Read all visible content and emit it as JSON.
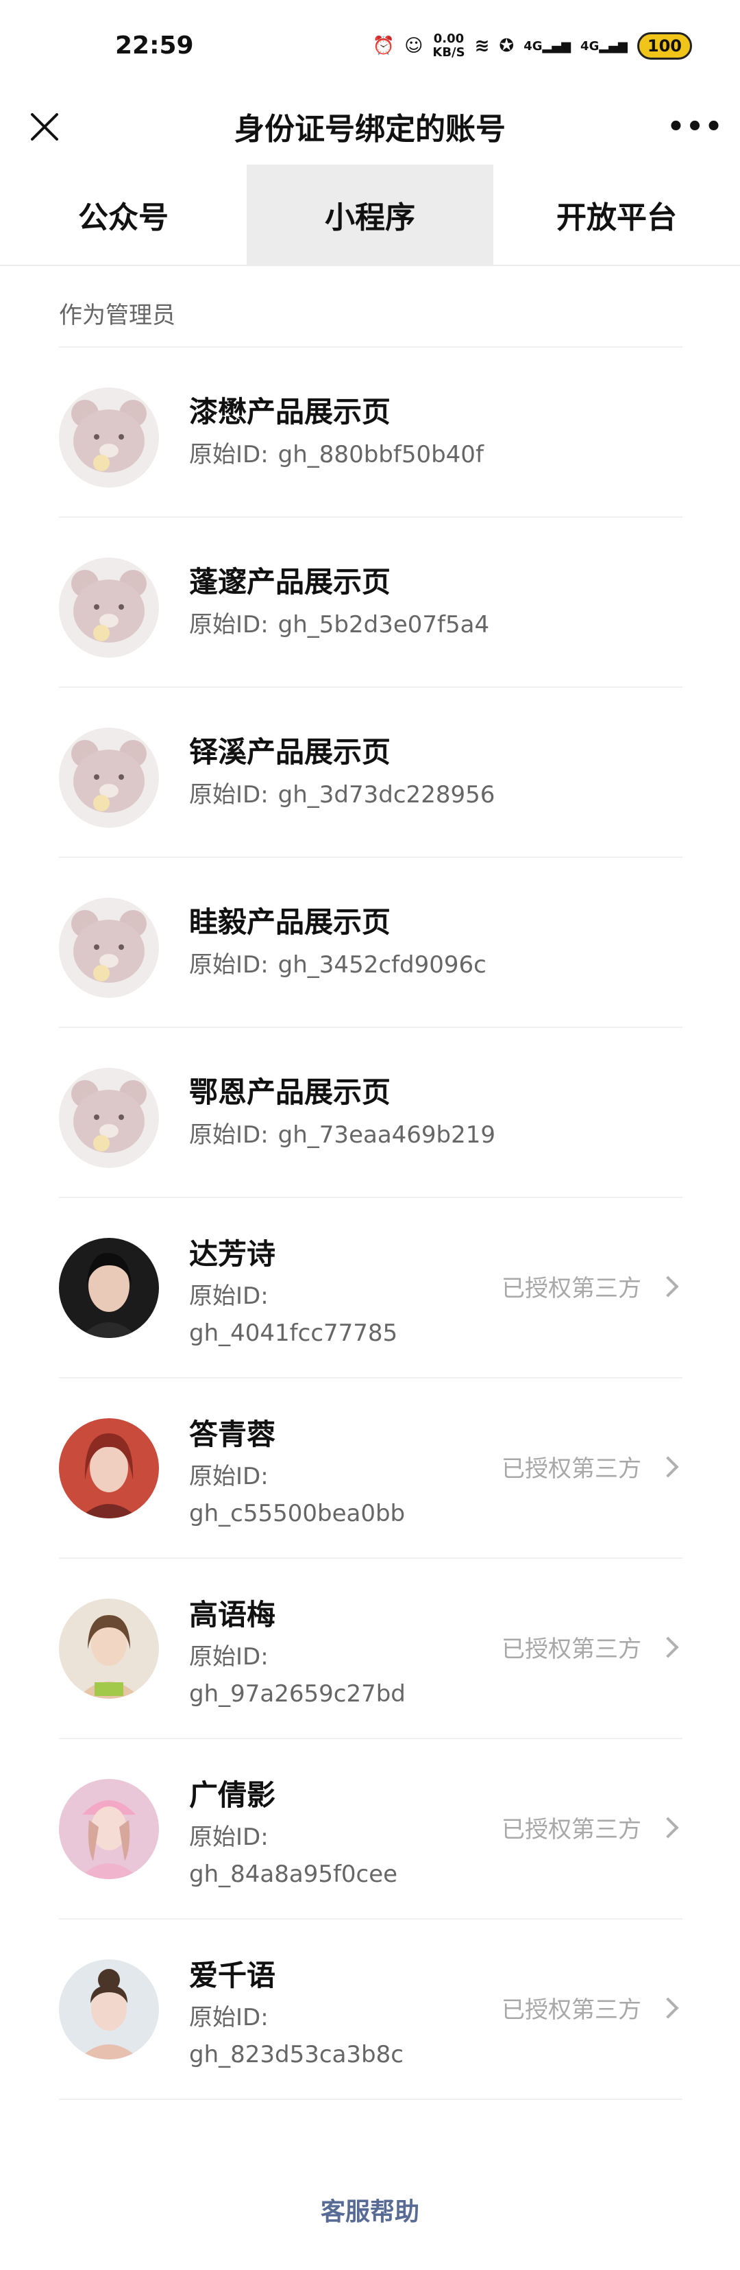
{
  "status_bar": {
    "time": "22:59",
    "speed_value": "0.00",
    "speed_unit": "KB/S",
    "signal_1": "4G",
    "signal_2": "4G",
    "battery": "100"
  },
  "title_bar": {
    "title": "身份证号绑定的账号",
    "close_icon": "close-icon",
    "more_icon": "more-icon"
  },
  "tabs": [
    {
      "label": "公众号",
      "active": false
    },
    {
      "label": "小程序",
      "active": true
    },
    {
      "label": "开放平台",
      "active": false
    }
  ],
  "section": {
    "header": "作为管理员"
  },
  "accounts": [
    {
      "name": "漆懋产品展示页",
      "id_label": "原始ID:",
      "id": "gh_880bbf50b40f",
      "avatar": "bear-avatar",
      "auth": ""
    },
    {
      "name": "蓬邃产品展示页",
      "id_label": "原始ID:",
      "id": "gh_5b2d3e07f5a4",
      "avatar": "bear-avatar",
      "auth": ""
    },
    {
      "name": "铎溪产品展示页",
      "id_label": "原始ID:",
      "id": "gh_3d73dc228956",
      "avatar": "bear-avatar",
      "auth": ""
    },
    {
      "name": "眭毅产品展示页",
      "id_label": "原始ID:",
      "id": "gh_3452cfd9096c",
      "avatar": "bear-avatar",
      "auth": ""
    },
    {
      "name": "鄂恩产品展示页",
      "id_label": "原始ID:",
      "id": "gh_73eaa469b219",
      "avatar": "bear-avatar",
      "auth": ""
    },
    {
      "name": "达芳诗",
      "id_label": "原始ID:",
      "id": "gh_4041fcc77785",
      "avatar": "photo-avatar",
      "auth": "已授权第三方"
    },
    {
      "name": "答青蓉",
      "id_label": "原始ID:",
      "id": "gh_c55500bea0bb",
      "avatar": "photo-avatar",
      "auth": "已授权第三方"
    },
    {
      "name": "高语梅",
      "id_label": "原始ID:",
      "id": "gh_97a2659c27bd",
      "avatar": "photo-avatar",
      "auth": "已授权第三方"
    },
    {
      "name": "广倩影",
      "id_label": "原始ID:",
      "id": "gh_84a8a95f0cee",
      "avatar": "photo-avatar",
      "auth": "已授权第三方"
    },
    {
      "name": "爱千语",
      "id_label": "原始ID:",
      "id": "gh_823d53ca3b8c",
      "avatar": "photo-avatar",
      "auth": "已授权第三方"
    }
  ],
  "footer": {
    "help": "客服帮助"
  },
  "colors": {
    "link": "#576b95",
    "muted": "#a8a8a8",
    "tab_active_bg": "#ececec"
  }
}
